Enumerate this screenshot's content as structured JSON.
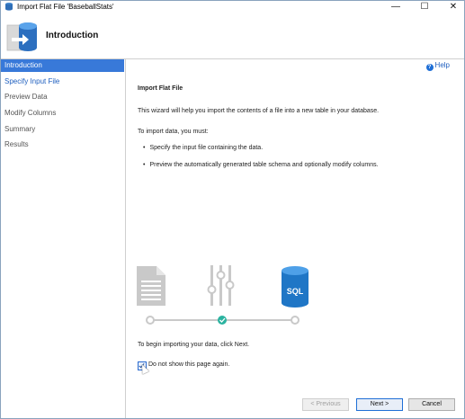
{
  "window": {
    "title": "Import Flat File 'BaseballStats'",
    "min_glyph": "—",
    "max_glyph": "☐",
    "close_glyph": "✕"
  },
  "header": {
    "title": "Introduction"
  },
  "nav": {
    "items": [
      {
        "label": "Introduction",
        "state": "active"
      },
      {
        "label": "Specify Input File",
        "state": "link"
      },
      {
        "label": "Preview Data",
        "state": "disabled"
      },
      {
        "label": "Modify Columns",
        "state": "disabled"
      },
      {
        "label": "Summary",
        "state": "disabled"
      },
      {
        "label": "Results",
        "state": "disabled"
      }
    ]
  },
  "main": {
    "help_label": "Help",
    "section_title": "Import Flat File",
    "intro": "This wizard will help you import the contents of a file into a new table in your database.",
    "must_label": "To import data, you must:",
    "bullets": [
      "Specify the input file containing the data.",
      "Preview the automatically generated table schema and optionally modify columns."
    ],
    "sql_badge": "SQL",
    "begin_text": "To begin importing your data, click Next.",
    "checkbox_label": "Do not show this page again.",
    "checkbox_checked": true
  },
  "buttons": {
    "previous": "< Previous",
    "next": "Next >",
    "cancel": "Cancel"
  },
  "colors": {
    "accent": "#3879d9",
    "link": "#1f5fbf",
    "sql_blue": "#1f76c6",
    "check_teal": "#2bb3a0"
  }
}
